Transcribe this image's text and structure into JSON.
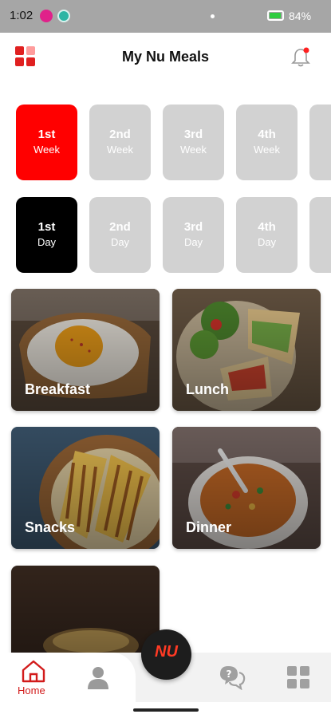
{
  "status_bar": {
    "time": "1:02",
    "battery": "84%"
  },
  "header": {
    "title": "My Nu Meals"
  },
  "weeks": [
    {
      "number": "1st",
      "unit": "Week",
      "active": true
    },
    {
      "number": "2nd",
      "unit": "Week",
      "active": false
    },
    {
      "number": "3rd",
      "unit": "Week",
      "active": false
    },
    {
      "number": "4th",
      "unit": "Week",
      "active": false
    }
  ],
  "days": [
    {
      "number": "1st",
      "unit": "Day",
      "active": true
    },
    {
      "number": "2nd",
      "unit": "Day",
      "active": false
    },
    {
      "number": "3rd",
      "unit": "Day",
      "active": false
    },
    {
      "number": "4th",
      "unit": "Day",
      "active": false
    }
  ],
  "meals": [
    {
      "label": "Breakfast"
    },
    {
      "label": "Lunch"
    },
    {
      "label": "Snacks"
    },
    {
      "label": "Dinner"
    }
  ],
  "bottom_nav": {
    "home_label": "Home",
    "fab_logo": "NU"
  },
  "colors": {
    "accent": "#ff0000",
    "day_active": "#000000",
    "inactive_tile": "#d2d2d2",
    "nav_active": "#d21b1b"
  },
  "icons": [
    "grid-menu-icon",
    "bell-icon",
    "home-icon",
    "profile-icon",
    "help-chat-icon",
    "apps-grid-icon"
  ]
}
